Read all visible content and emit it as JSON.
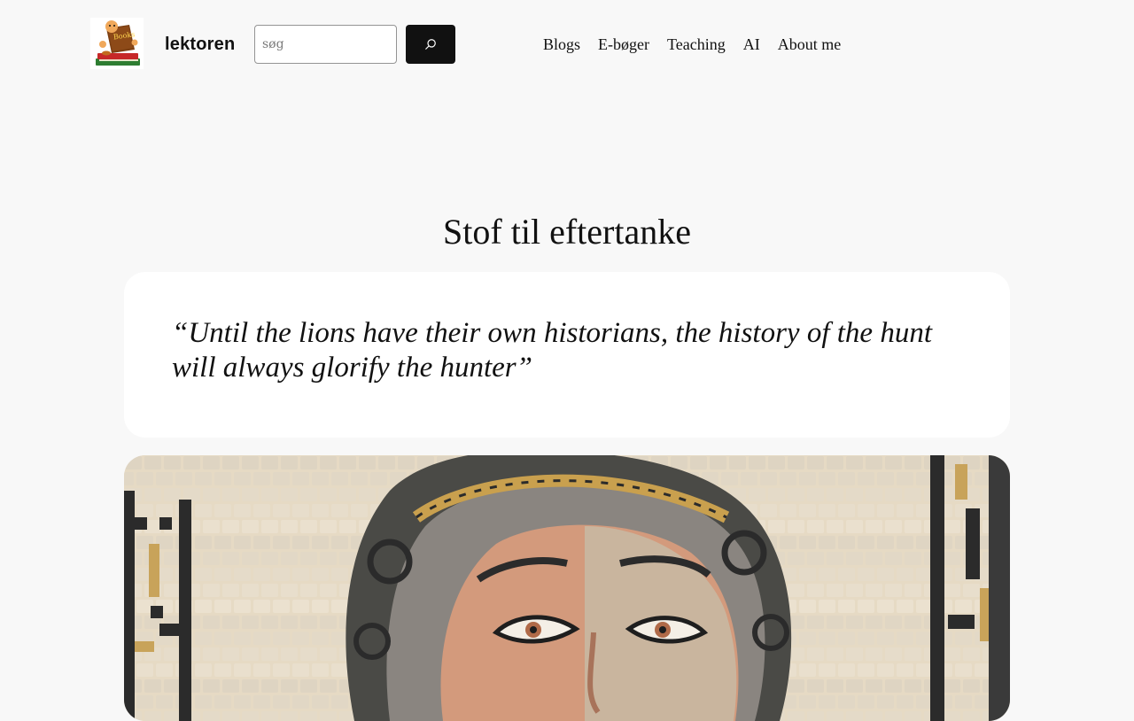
{
  "header": {
    "logo_icon": "books-reader-logo-icon",
    "site_title": "lektoren",
    "search": {
      "placeholder": "søg",
      "value": "",
      "button_icon": "search-icon"
    },
    "nav": [
      {
        "label": "Blogs"
      },
      {
        "label": "E-bøger"
      },
      {
        "label": "Teaching"
      },
      {
        "label": "AI"
      },
      {
        "label": "About me"
      }
    ]
  },
  "main": {
    "title": "Stof til eftertanke",
    "quote": "“Until the lions have their own historians, the history of the hunt will always glorify the hunter”",
    "image_icon": "mosaic-face-image"
  },
  "colors": {
    "background": "#f8f8f8",
    "card": "#ffffff",
    "text": "#111111",
    "button": "#111111"
  }
}
